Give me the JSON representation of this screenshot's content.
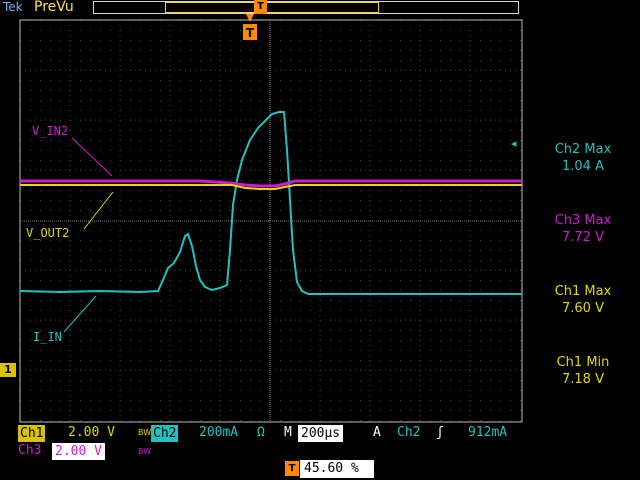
{
  "header": {
    "brand": "Tek",
    "mode": "PreVu",
    "trigger_glyph": "T"
  },
  "colors": {
    "ch1": "#d9c300",
    "ch2": "#22c2c2",
    "ch3": "#d21ad2",
    "trigger": "#ff8a00",
    "graticule": "#bdbdbd"
  },
  "waveform_labels": {
    "v_in2": "V_IN2",
    "v_out2": "V_OUT2",
    "i_in": "I_IN"
  },
  "measurements": [
    {
      "label": "Ch2 Max",
      "value": "1.04 A",
      "color": "#22c2c2"
    },
    {
      "label": "Ch3 Max",
      "value": "7.72 V",
      "color": "#d21ad2"
    },
    {
      "label": "Ch1 Max",
      "value": "7.60 V",
      "color": "#d9c300"
    },
    {
      "label": "Ch1 Min",
      "value": "7.18 V",
      "color": "#d9c300"
    }
  ],
  "ground_marker": "1",
  "status": {
    "ch1_label": "Ch1",
    "ch1_scale": "2.00 V",
    "ch2_label": "Ch2",
    "ch2_scale": "200mA",
    "ohm_symbol": "Ω",
    "bw_symbol": "BW",
    "timebase_label": "M",
    "timebase": "200µs",
    "trigger_mode": "A",
    "trigger_source": "Ch2",
    "trigger_slope": "ʃ",
    "trigger_level": "912mA",
    "ch3_label": "Ch3",
    "ch3_scale": "2.00 V",
    "trigger_position": "45.60 %"
  }
}
